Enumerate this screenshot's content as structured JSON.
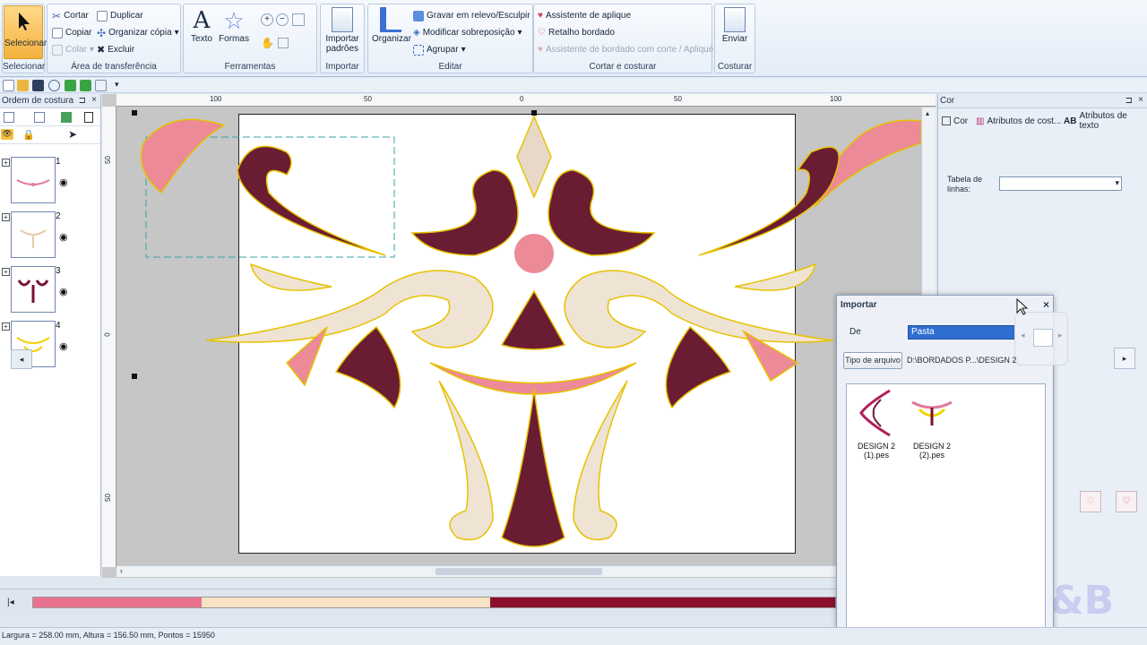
{
  "ribbon": {
    "select": {
      "label": "Selecionar",
      "group": "Selecionar"
    },
    "clipboard": {
      "cut": "Cortar",
      "copy": "Copiar",
      "paste": "Colar",
      "duplicate": "Duplicar",
      "arrange_copy": "Organizar cópia",
      "delete": "Excluir",
      "group": "Área de transferência"
    },
    "tools": {
      "text": "Texto",
      "shapes": "Formas",
      "group": "Ferramentas"
    },
    "import": {
      "label": "Importar padrões",
      "group": "Importar"
    },
    "edit": {
      "arrange": "Organizar",
      "emboss": "Gravar em relevo/Esculpir",
      "overlap": "Modificar sobreposição",
      "group_btn": "Agrupar",
      "group": "Editar"
    },
    "cut_sew": {
      "applique": "Assistente de aplique",
      "patch": "Retalho bordado",
      "cutwork": "Assistente de bordado com corte / Apliqué",
      "group": "Cortar e costurar"
    },
    "send": {
      "label": "Enviar",
      "group": "Costurar"
    }
  },
  "sewing_order": {
    "title": "Ordem de costura",
    "items": [
      {
        "num": "1",
        "color": "#e07aa0"
      },
      {
        "num": "2",
        "color": "#eacaa8"
      },
      {
        "num": "3",
        "color": "#7a1030"
      },
      {
        "num": "4",
        "color": "#f2d200"
      }
    ]
  },
  "rulers": {
    "top": [
      "100",
      "50",
      "0",
      "50",
      "100"
    ],
    "left": [
      "50",
      "0",
      "50"
    ]
  },
  "color_panel": {
    "title": "Cor",
    "tabs": [
      "Cor",
      "Atributos de cost...",
      "Atributos de texto"
    ],
    "table_label": "Tabela de linhas:",
    "table_value": ""
  },
  "import_dialog": {
    "title": "Importar",
    "from_label": "De",
    "from_value": "Pasta",
    "file_type_button": "Tipo de arquivo",
    "path": "D:\\BORDADOS P...\\DESIGN 2",
    "files": [
      {
        "name": "DESIGN 2",
        "file": "(1).pes"
      },
      {
        "name": "DESIGN 2",
        "file": "(2).pes"
      }
    ]
  },
  "color_bar": [
    {
      "color": "#e9738f",
      "fraction": 0.21
    },
    {
      "color": "#f9e2c4",
      "fraction": 0.36
    },
    {
      "color": "#8c0f2c",
      "fraction": 0.43
    }
  ],
  "status": {
    "text": "Largura = 258.00 mm, Altura = 156.50 mm, Pontos = 15950"
  },
  "watermark": "K&B"
}
